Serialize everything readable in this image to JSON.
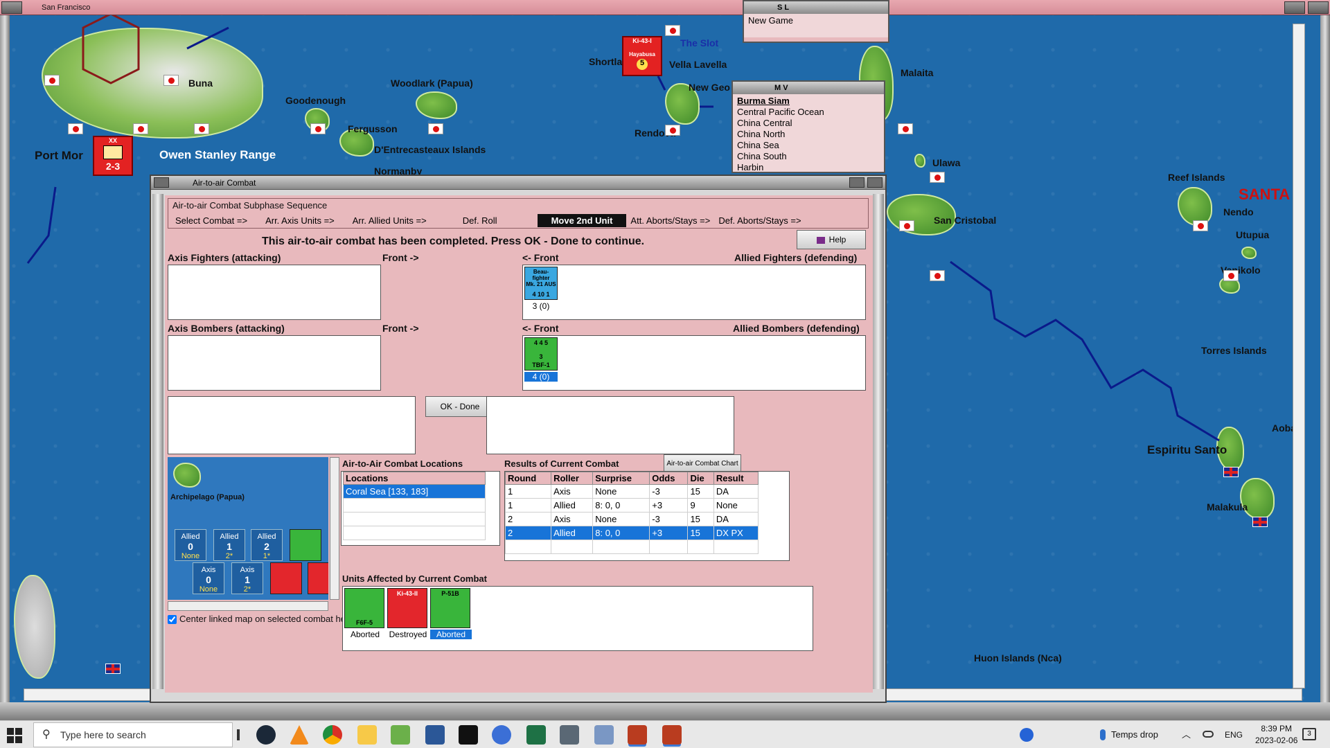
{
  "window": {
    "title": "San Francisco"
  },
  "map": {
    "places": [
      "Buna",
      "Woodlark (Papua)",
      "Goodenough",
      "Fergusson",
      "Port Mor",
      "Owen Stanley Range",
      "D'Entrecasteaux Islands",
      "Normanby",
      "The Slot",
      "Vella Lavella",
      "Shortla",
      "New Geo",
      "Rendova",
      "Malaita",
      "Ulawa",
      "San Cristobal",
      "Reef Islands",
      "SANTA",
      "Nendo",
      "Utupua",
      "Vanikolo",
      "Torres Islands",
      "Espiritu Santo",
      "Aoba",
      "Malakula",
      "Huon Islands (Nca)"
    ],
    "counter_port": {
      "top": "XX",
      "bottom": "2-3"
    },
    "counter_slot": {
      "top": "Ki-43-I",
      "mid": "Hayabusa",
      "bottom": "5"
    }
  },
  "sl_window": {
    "title": "S L",
    "items": [
      "New Game"
    ]
  },
  "mv_window": {
    "title": "M V",
    "items": [
      "Burma Siam",
      "Central Pacific Ocean",
      "China Central",
      "China North",
      "China Sea",
      "China South",
      "Harbin"
    ]
  },
  "dialog": {
    "title": "Air-to-air Combat",
    "sequence_title": "Air-to-air Combat Subphase Sequence",
    "steps": [
      "Select Combat =>",
      "Arr. Axis Units =>",
      "Arr. Allied Units =>",
      "Def. Roll",
      "Move 2nd Unit",
      "Att. Aborts/Stays =>",
      "Def. Aborts/Stays =>"
    ],
    "message": "This air-to-air combat has been completed.  Press OK - Done to continue.",
    "help_label": "Help",
    "axis_fighters_label": "Axis Fighters (attacking)",
    "front_right": "Front ->",
    "front_left": "<- Front",
    "allied_fighters_label": "Allied Fighters (defending)",
    "axis_bombers_label": "Axis Bombers (attacking)",
    "allied_bombers_label": "Allied Bombers (defending)",
    "allied_fighter_unit": {
      "top": "Beau-fighter",
      "mid": "Mk. 21 AUS",
      "bottom": "4 10 1",
      "caption": "3 (0)"
    },
    "allied_bomber_unit": {
      "top": "4  4  5",
      "mid": "3",
      "bottom": "TBF-1",
      "caption": "4 (0)"
    },
    "ok_label": "OK - Done",
    "minimap": {
      "place": "Archipelago (Papua)",
      "allied": [
        {
          "name": "Allied",
          "value": "0",
          "extra": "None"
        },
        {
          "name": "Allied",
          "value": "1",
          "extra": "2*"
        },
        {
          "name": "Allied",
          "value": "2",
          "extra": "1*"
        }
      ],
      "axis": [
        {
          "name": "Axis",
          "value": "0",
          "extra": "None"
        },
        {
          "name": "Axis",
          "value": "1",
          "extra": "2*"
        }
      ],
      "center_checkbox": "Center linked map on selected combat hex"
    },
    "locations_title": "Air-to-Air Combat Locations",
    "locations_header": "Locations",
    "locations": [
      "Coral Sea [133, 183]"
    ],
    "results_title": "Results of Current Combat",
    "chart_button": "Air-to-air Combat Chart",
    "results_columns": [
      "Round",
      "Roller",
      "Surprise",
      "Odds",
      "Die",
      "Result"
    ],
    "results_rows": [
      [
        "1",
        "Axis",
        "None",
        "-3",
        "15",
        "DA"
      ],
      [
        "1",
        "Allied",
        "8: 0, 0",
        "+3",
        "9",
        "None"
      ],
      [
        "2",
        "Axis",
        "None",
        "-3",
        "15",
        "DA"
      ],
      [
        "2",
        "Allied",
        "8: 0, 0",
        "+3",
        "15",
        "DX PX"
      ]
    ],
    "affected_title": "Units Affected by Current Combat",
    "affected": [
      {
        "unit": "F6F-5",
        "status": "Aborted",
        "color": "#39b53b"
      },
      {
        "unit": "Ki-43-II",
        "status": "Destroyed",
        "color": "#e3262c"
      },
      {
        "unit": "P-51B",
        "status": "Aborted",
        "color": "#39b53b"
      }
    ]
  },
  "taskbar": {
    "search_placeholder": "Type here to search",
    "weather": "Temps drop",
    "lang": "ENG",
    "time": "8:39 PM",
    "date": "2023-02-06",
    "notification_count": "3"
  }
}
